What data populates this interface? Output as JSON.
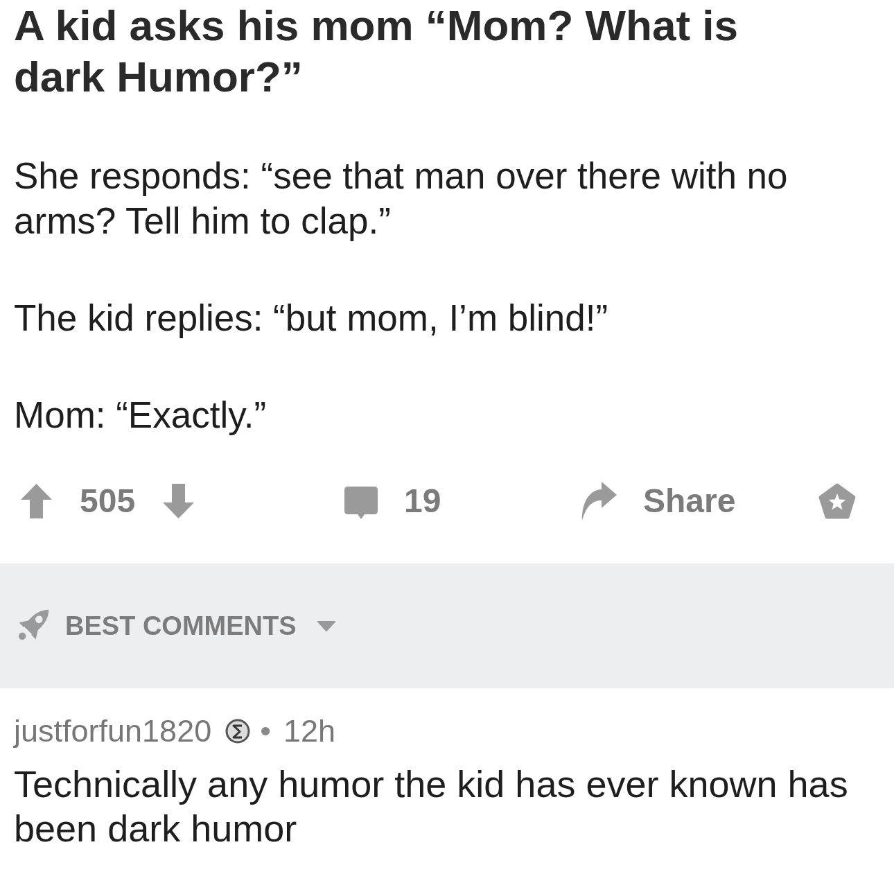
{
  "post": {
    "title": "A kid asks his mom “Mom? What is dark Humor?”",
    "paragraphs": [
      "She responds: “see that man over there with no arms? Tell him to clap.”",
      "The kid replies: “but mom, I’m blind!”",
      "Mom: “Exactly.”"
    ]
  },
  "actions": {
    "score": "505",
    "comment_count": "19",
    "share_label": "Share"
  },
  "comments_sort": {
    "label": "BEST COMMENTS"
  },
  "comments": [
    {
      "author": "justforfun1820",
      "separator": "•",
      "age": "12h",
      "body": "Technically any humor the kid has ever known has been dark humor"
    }
  ]
}
